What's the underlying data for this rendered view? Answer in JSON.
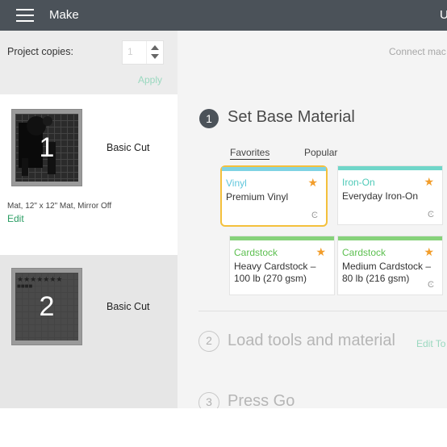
{
  "header": {
    "title": "Make",
    "right_text": "U",
    "menu_icon": "hamburger-menu-icon",
    "bg_color": "#4b5259"
  },
  "left_panel": {
    "copies_label": "Project copies:",
    "copies_value": "1",
    "apply_label": "Apply",
    "mats": [
      {
        "number": "1",
        "label": "Basic Cut",
        "description": "Mat, 12\" x 12\" Mat, Mirror Off",
        "edit_label": "Edit"
      },
      {
        "number": "2",
        "label": "Basic Cut"
      }
    ]
  },
  "right_panel": {
    "connect_text": "Connect mac",
    "step1": {
      "number": "1",
      "title": "Set Base Material"
    },
    "tabs": [
      {
        "label": "Favorites",
        "active": true
      },
      {
        "label": "Popular",
        "active": false
      }
    ],
    "materials": [
      {
        "type": "Vinyl",
        "name": "Premium Vinyl",
        "accent": "#7fd3e3",
        "type_color": "#5fc6dc",
        "favorite": true,
        "selected": true
      },
      {
        "type": "Iron-On",
        "name": "Everyday Iron-On",
        "accent": "#6fd6c9",
        "type_color": "#4fcab8",
        "favorite": true,
        "selected": false
      },
      {
        "type": "Cardstock",
        "name": "Heavy Cardstock – 100 lb (270 gsm)",
        "accent": "#86d27a",
        "type_color": "#5cbf4f",
        "favorite": true,
        "selected": false
      },
      {
        "type": "Cardstock",
        "name": "Medium Cardstock – 80 lb (216 gsm)",
        "accent": "#86d27a",
        "type_color": "#5cbf4f",
        "favorite": true,
        "selected": false
      }
    ],
    "step2": {
      "number": "2",
      "title": "Load tools and material",
      "edit_tools_label": "Edit To"
    },
    "step3": {
      "number": "3",
      "title": "Press Go"
    }
  },
  "colors": {
    "accent_green": "#2a9d63",
    "selected_border": "#f4c03c",
    "star": "#f29d2b"
  }
}
